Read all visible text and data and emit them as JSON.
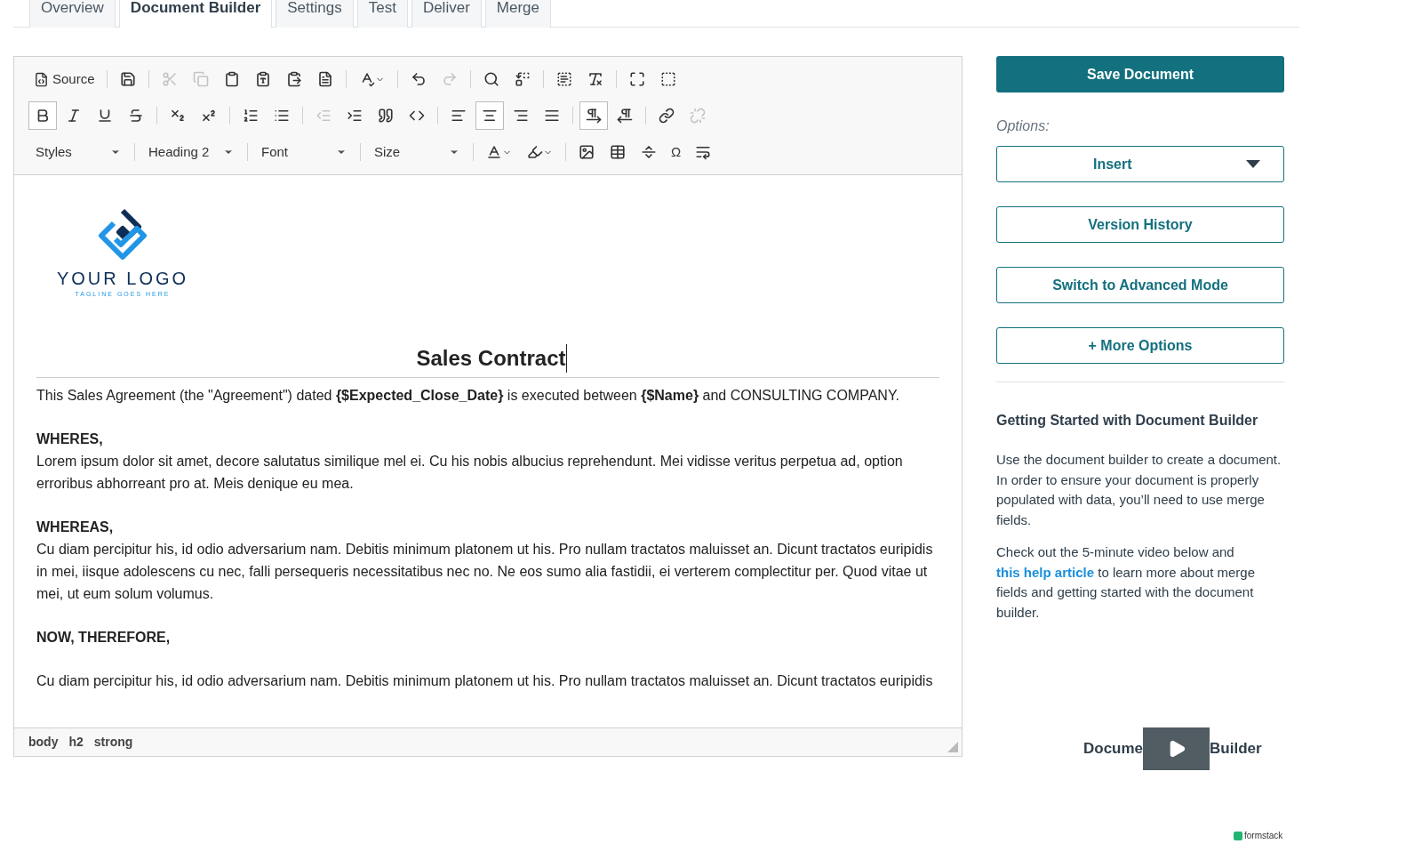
{
  "tabs": [
    {
      "label": "Overview",
      "selected": false
    },
    {
      "label": "Document Builder",
      "selected": true
    },
    {
      "label": "Settings",
      "selected": false
    },
    {
      "label": "Test",
      "selected": false
    },
    {
      "label": "Deliver",
      "selected": false
    },
    {
      "label": "Merge",
      "selected": false
    }
  ],
  "toolbar": {
    "rows": [
      [
        {
          "kind": "text",
          "label": "Source"
        },
        {
          "kind": "sep"
        },
        {
          "kind": "button"
        },
        {
          "kind": "sep"
        },
        {
          "kind": "button",
          "disabled": true
        },
        {
          "kind": "button",
          "disabled": true
        },
        {
          "kind": "button"
        },
        {
          "kind": "button"
        },
        {
          "kind": "button"
        },
        {
          "kind": "button"
        },
        {
          "kind": "sep"
        },
        {
          "kind": "menu"
        },
        {
          "kind": "sep"
        },
        {
          "kind": "button"
        },
        {
          "kind": "button",
          "disabled": true
        },
        {
          "kind": "sep"
        },
        {
          "kind": "button"
        },
        {
          "kind": "button"
        },
        {
          "kind": "sep"
        },
        {
          "kind": "button"
        },
        {
          "kind": "button"
        },
        {
          "kind": "sep"
        },
        {
          "kind": "button"
        },
        {
          "kind": "button"
        }
      ],
      [
        {
          "kind": "button",
          "pressed": true
        },
        {
          "kind": "button",
          "pressed": false
        },
        {
          "kind": "button",
          "pressed": false
        },
        {
          "kind": "button",
          "pressed": false
        },
        {
          "kind": "sep"
        },
        {
          "kind": "button",
          "pressed": false
        },
        {
          "kind": "button",
          "pressed": false
        },
        {
          "kind": "sep"
        },
        {
          "kind": "button",
          "pressed": false
        },
        {
          "kind": "button",
          "pressed": false
        },
        {
          "kind": "sep"
        },
        {
          "kind": "button",
          "disabled": true
        },
        {
          "kind": "button"
        },
        {
          "kind": "button"
        },
        {
          "kind": "button"
        },
        {
          "kind": "sep"
        },
        {
          "kind": "button",
          "pressed": false
        },
        {
          "kind": "button",
          "pressed": true
        },
        {
          "kind": "button",
          "pressed": false
        },
        {
          "kind": "button",
          "pressed": false
        },
        {
          "kind": "sep"
        },
        {
          "kind": "button",
          "pressed": true
        },
        {
          "kind": "button",
          "pressed": false
        },
        {
          "kind": "sep"
        },
        {
          "kind": "button"
        },
        {
          "kind": "button",
          "disabled": true
        }
      ],
      [
        {
          "kind": "combo",
          "label": "Styles"
        },
        {
          "kind": "sep"
        },
        {
          "kind": "combo",
          "label": "Heading 2"
        },
        {
          "kind": "sep"
        },
        {
          "kind": "combo",
          "label": "Font"
        },
        {
          "kind": "sep"
        },
        {
          "kind": "combo",
          "label": "Size"
        },
        {
          "kind": "sep"
        },
        {
          "kind": "menu"
        },
        {
          "kind": "menu"
        },
        {
          "kind": "sep"
        },
        {
          "kind": "button"
        },
        {
          "kind": "button"
        },
        {
          "kind": "button"
        },
        {
          "kind": "text",
          "label": "Ω"
        },
        {
          "kind": "button"
        }
      ]
    ]
  },
  "document": {
    "logo": {
      "name": "YOUR LOGO",
      "tagline": "TAGLINE GOES HERE"
    },
    "heading": "Sales Contract",
    "blocks": [
      {
        "kind": "para",
        "text": "This Sales Agreement (the \"Agreement\") dated **{$Expected_Close_Date}** is executed between **{$Name}** and CONSULTING COMPANY."
      },
      {
        "kind": "label",
        "text": "WHERES,"
      },
      {
        "kind": "para",
        "text": "Lorem ipsum dolor sit amet, decore salutatus similique mel ei. Cu his nobis albucius reprehendunt. Mei vidisse veritus perpetua ad, option erroribus abhorreant pro at. Meis denique eu mea."
      },
      {
        "kind": "label",
        "text": "WHEREAS,"
      },
      {
        "kind": "para",
        "text": "Cu diam percipitur his, id odio adversarium nam. Debitis minimum platonem ut his. Pro nullam tractatos maluisset an. Dicunt tractatos euripidis in mei, iisque adolescens cu nec, falli persequeris necessitatibus nec no. Ne eos sumo alia fastidii, ei verterem complectitur per. Quod vitae ut mei, ut eum solum volumus."
      },
      {
        "kind": "label",
        "text": "NOW, THEREFORE,"
      },
      {
        "kind": "para",
        "text": "Cu diam percipitur his, id odio adversarium nam. Debitis minimum platonem ut his. Pro nullam tractatos maluisset an. Dicunt tractatos euripidis"
      }
    ]
  },
  "path": [
    "body",
    "h2",
    "strong"
  ],
  "save_button": "Save Document",
  "options_label": "Options:",
  "insert": {
    "label": "Insert"
  },
  "buttons": [
    "Version History",
    "Switch to Advanced Mode",
    "+ More Options"
  ],
  "help": {
    "title": "Getting Started with Document Builder",
    "intro": "Use the document builder to create a document. In order to ensure your document is properly populated with data, you’ll need to use merge fields.",
    "before_link": "Check out the 5-minute video below and ",
    "link": "this help article",
    "after_link": " to learn more about merge fields and getting started with the document builder."
  },
  "video": {
    "title_left": "Docume",
    "title_right": "Builder"
  },
  "brand": "formstack"
}
